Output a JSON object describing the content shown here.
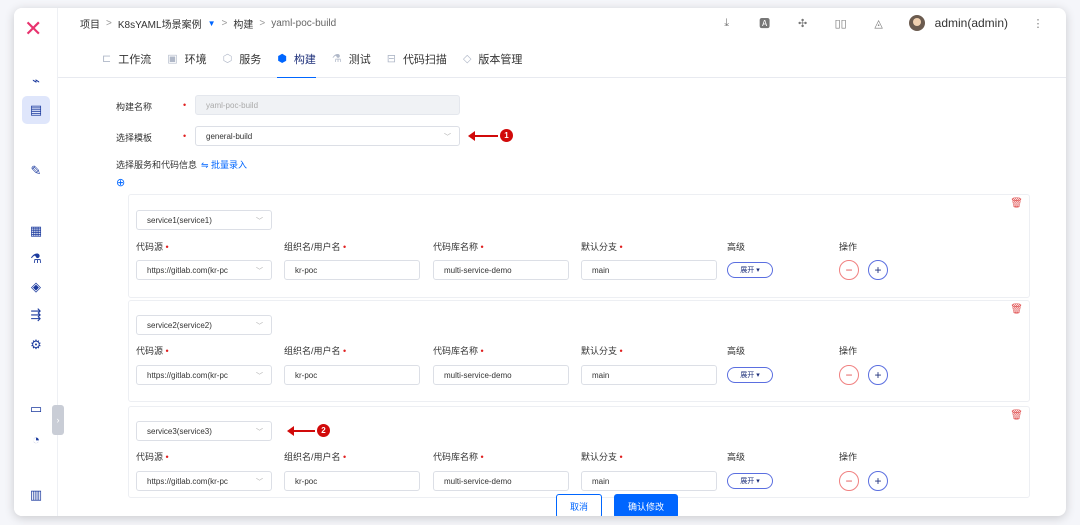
{
  "logo": "✕",
  "breadcrumb": {
    "items": [
      "项目",
      "K8sYAML场景案例",
      "构建",
      "yaml-poc-build"
    ],
    "sep": ">"
  },
  "topbar": {
    "user": "admin(admin)"
  },
  "tabs": [
    {
      "label": "工作流"
    },
    {
      "label": "环境"
    },
    {
      "label": "服务"
    },
    {
      "label": "构建",
      "active": true
    },
    {
      "label": "测试"
    },
    {
      "label": "代码扫描"
    },
    {
      "label": "版本管理"
    }
  ],
  "form": {
    "name_label": "构建名称",
    "name_placeholder": "yaml-poc-build",
    "template_label": "选择模板",
    "template_value": "general-build",
    "services_label": "选择服务和代码信息",
    "batch_link": "⇋ 批量录入",
    "add_icon": "⊕"
  },
  "annotations": {
    "one": "1",
    "two": "2"
  },
  "columns": {
    "source": "代码源",
    "org": "组织名/用户名",
    "repo": "代码库名称",
    "branch": "默认分支",
    "advanced": "高级",
    "ops": "操作"
  },
  "services": [
    {
      "name": "service1(service1)",
      "source": "https://gitlab.com(kr-pc",
      "org": "kr-poc",
      "repo": "multi-service-demo",
      "branch": "main",
      "expand": "展开 ▾"
    },
    {
      "name": "service2(service2)",
      "source": "https://gitlab.com(kr-pc",
      "org": "kr-poc",
      "repo": "multi-service-demo",
      "branch": "main",
      "expand": "展开 ▾"
    },
    {
      "name": "service3(service3)",
      "source": "https://gitlab.com(kr-pc",
      "org": "kr-poc",
      "repo": "multi-service-demo",
      "branch": "main",
      "expand": "展开 ▾"
    }
  ],
  "buttons": {
    "cancel": "取消",
    "confirm": "确认修改"
  },
  "colors": {
    "accent": "#0066ff",
    "danger": "#d10a0a",
    "brand": "#e8336e"
  }
}
